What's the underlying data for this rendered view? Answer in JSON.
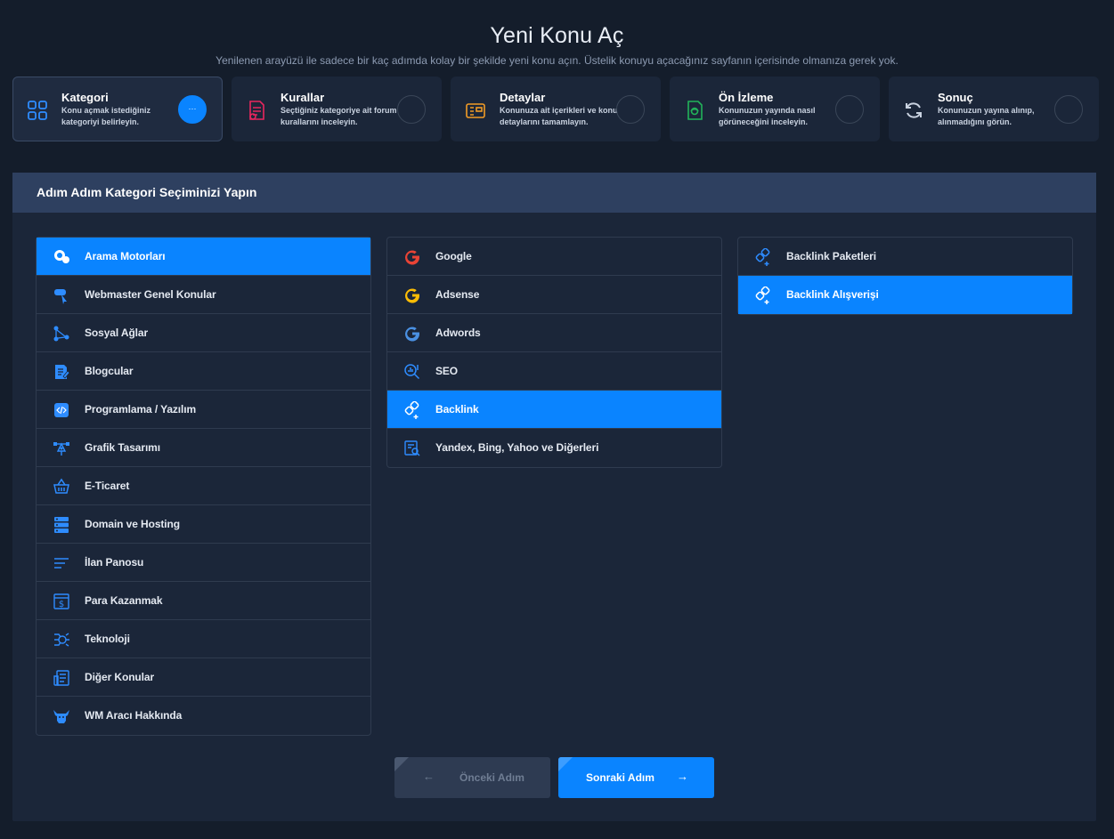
{
  "header": {
    "title": "Yeni Konu Aç",
    "subtitle": "Yenilenen arayüzü ile sadece bir kaç adımda kolay bir şekilde yeni konu açın. Üstelik konuyu açacağınız sayfanın içerisinde olmanıza gerek yok."
  },
  "steps": [
    {
      "title": "Kategori",
      "desc": "Konu açmak istediğiniz kategoriyi belirleyin.",
      "icon": "grid-icon",
      "status": "···",
      "color": "#0a84ff"
    },
    {
      "title": "Kurallar",
      "desc": "Seçtiğiniz kategoriye ait forum kurallarını inceleyin.",
      "icon": "rules-doc-icon",
      "status": "",
      "color": "#e8265e"
    },
    {
      "title": "Detaylar",
      "desc": "Konunuza ait içerikleri ve konu detaylarını tamamlayın.",
      "icon": "details-panel-icon",
      "status": "",
      "color": "#f29b26"
    },
    {
      "title": "Ön İzleme",
      "desc": "Konunuzun yayında nasıl görüneceğini inceleyin.",
      "icon": "preview-doc-icon",
      "status": "",
      "color": "#22b35a"
    },
    {
      "title": "Sonuç",
      "desc": "Konunuzun yayına alınıp, alınmadığını görün.",
      "icon": "refresh-icon",
      "status": "",
      "color": "#c9d2e0"
    }
  ],
  "panel": {
    "title": "Adım Adım Kategori Seçiminizi Yapın"
  },
  "categories": [
    {
      "label": "Arama Motorları",
      "icon": "search-engine-icon",
      "selected": true
    },
    {
      "label": "Webmaster Genel Konular",
      "icon": "webmaster-icon",
      "selected": false
    },
    {
      "label": "Sosyal Ağlar",
      "icon": "social-network-icon",
      "selected": false
    },
    {
      "label": "Blogcular",
      "icon": "blog-edit-icon",
      "selected": false
    },
    {
      "label": "Programlama / Yazılım",
      "icon": "code-icon",
      "selected": false
    },
    {
      "label": "Grafik Tasarımı",
      "icon": "vector-pen-icon",
      "selected": false
    },
    {
      "label": "E-Ticaret",
      "icon": "basket-icon",
      "selected": false
    },
    {
      "label": "Domain ve Hosting",
      "icon": "server-icon",
      "selected": false
    },
    {
      "label": "İlan Panosu",
      "icon": "list-lines-icon",
      "selected": false
    },
    {
      "label": "Para Kazanmak",
      "icon": "money-icon",
      "selected": false
    },
    {
      "label": "Teknoloji",
      "icon": "technology-icon",
      "selected": false
    },
    {
      "label": "Diğer Konular",
      "icon": "document-icon",
      "selected": false
    },
    {
      "label": "WM Aracı Hakkında",
      "icon": "bull-icon",
      "selected": false
    }
  ],
  "subcategories": [
    {
      "label": "Google",
      "icon": "google-icon",
      "color": "#e84335",
      "selected": false
    },
    {
      "label": "Adsense",
      "icon": "google-icon",
      "color": "#fbbc05",
      "selected": false
    },
    {
      "label": "Adwords",
      "icon": "google-icon",
      "color": "#4a90e2",
      "selected": false
    },
    {
      "label": "SEO",
      "icon": "seo-search-icon",
      "color": "#2e8cff",
      "selected": false
    },
    {
      "label": "Backlink",
      "icon": "backlink-icon",
      "color": "#ffffff",
      "selected": true
    },
    {
      "label": "Yandex, Bing, Yahoo ve Diğerleri",
      "icon": "search-doc-icon",
      "color": "#2e8cff",
      "selected": false
    }
  ],
  "leaves": [
    {
      "label": "Backlink Paketleri",
      "icon": "backlink-icon",
      "color": "#2e8cff",
      "selected": false
    },
    {
      "label": "Backlink Alışverişi",
      "icon": "backlink-icon",
      "color": "#ffffff",
      "selected": true
    }
  ],
  "buttons": {
    "prev_label": "Önceki Adım",
    "prev_arrow": "←",
    "next_label": "Sonraki Adım",
    "next_arrow": "→"
  }
}
